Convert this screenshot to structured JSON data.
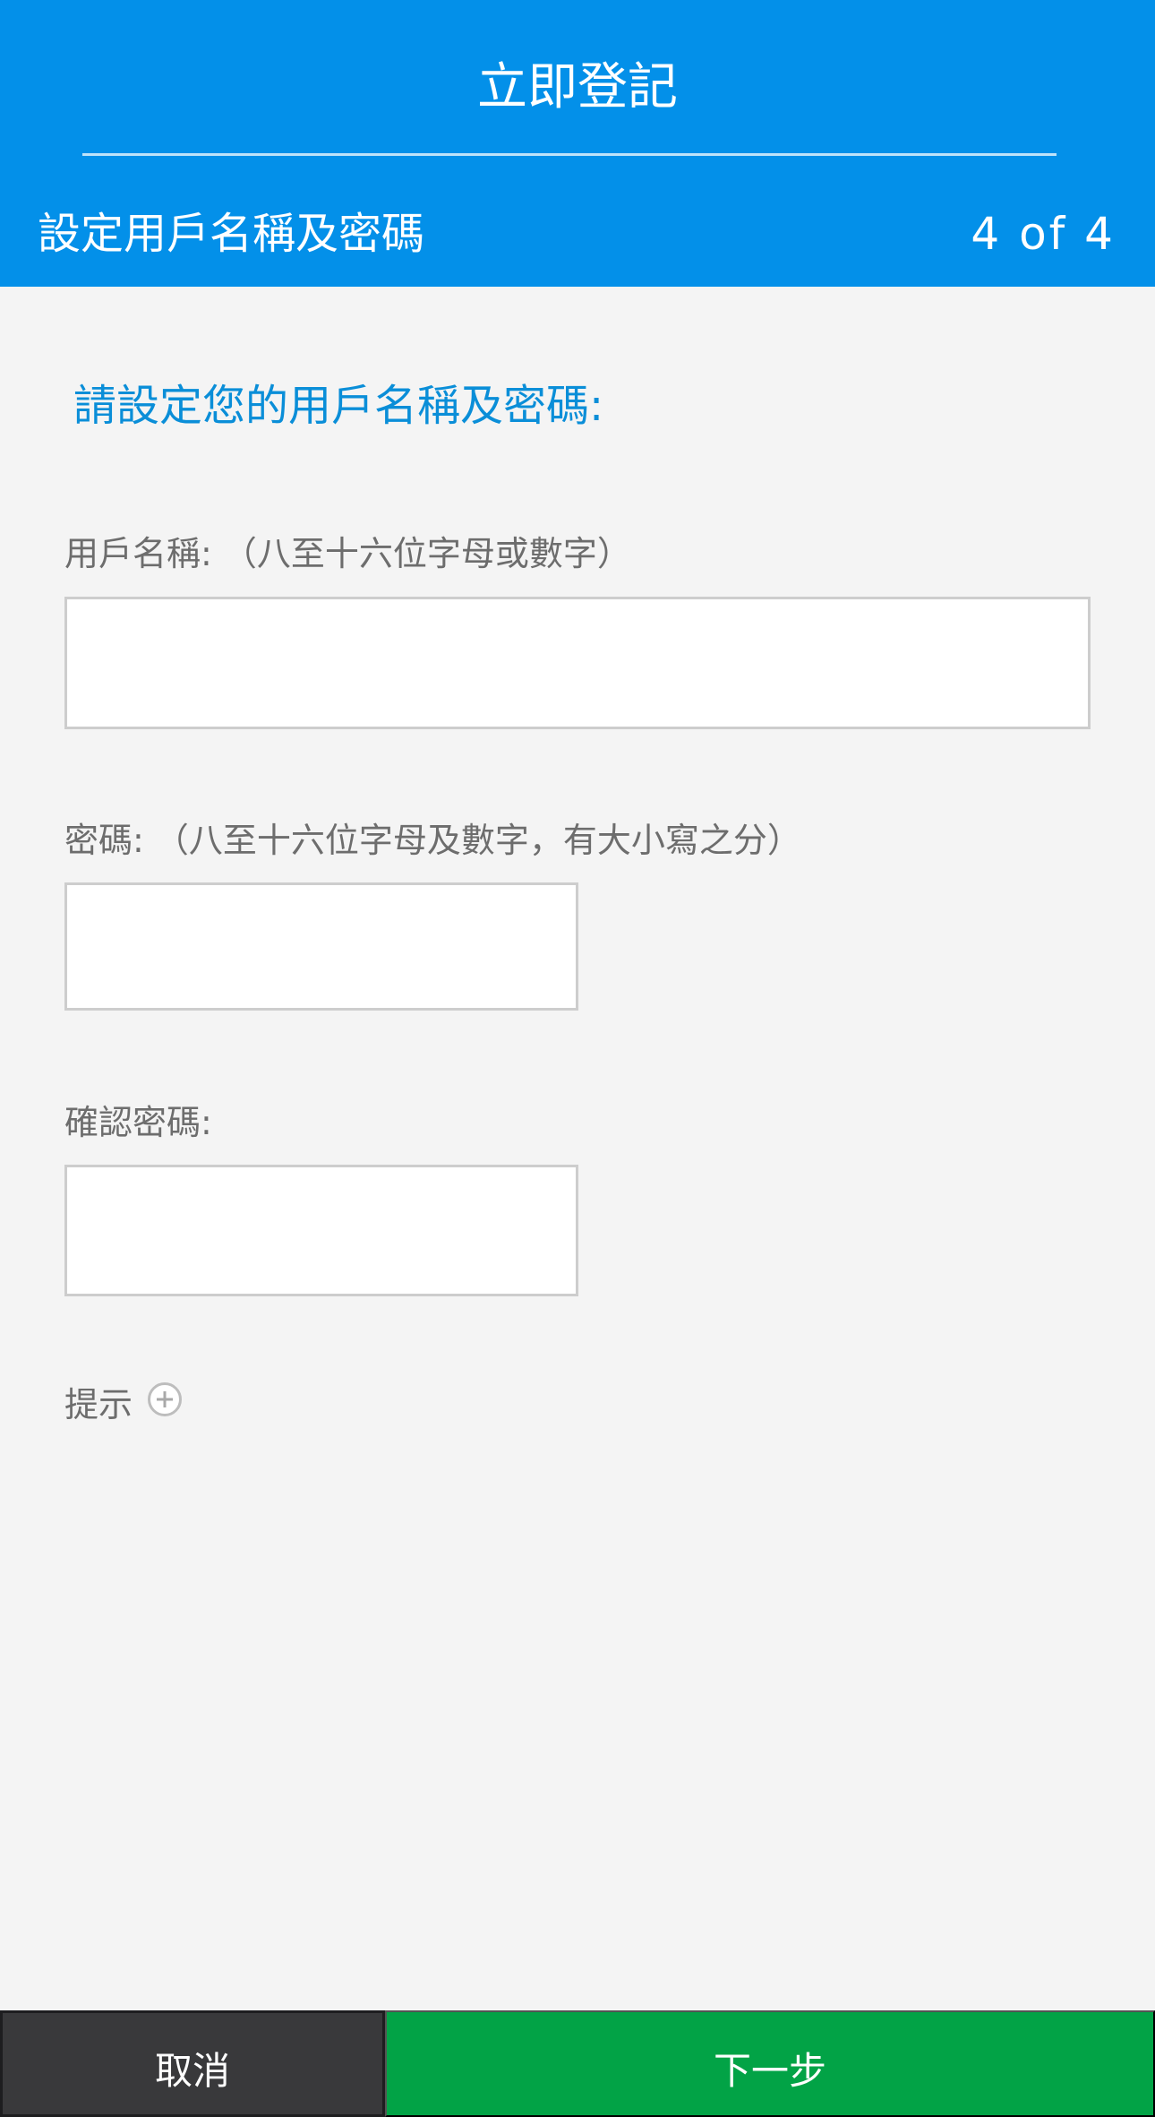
{
  "header": {
    "title": "立即登記",
    "step_title": "設定用戶名稱及密碼",
    "step_counter": "4 of 4"
  },
  "form": {
    "instruction": "請設定您的用戶名稱及密碼:",
    "username": {
      "label": "用戶名稱: （八至十六位字母或數字）",
      "value": "",
      "placeholder": ""
    },
    "password": {
      "label": "密碼: （八至十六位字母及數字，有大小寫之分）",
      "value": "",
      "placeholder": ""
    },
    "confirm_password": {
      "label": "確認密碼:",
      "value": "",
      "placeholder": ""
    },
    "hint": {
      "label": "提示",
      "icon": "plus-circle-icon"
    }
  },
  "footer": {
    "cancel_label": "取消",
    "next_label": "下一步"
  },
  "colors": {
    "header_bg": "#0390e9",
    "instruction_text": "#0a8ed8",
    "page_bg": "#f4f4f4",
    "cancel_bg": "#39393b",
    "next_bg": "#02a346"
  }
}
